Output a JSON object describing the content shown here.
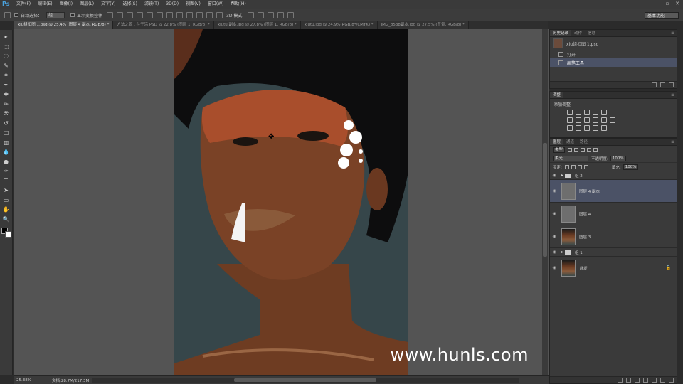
{
  "app": {
    "logo": "Ps",
    "menu": [
      "文件(F)",
      "编辑(E)",
      "图像(I)",
      "图层(L)",
      "文字(Y)",
      "选择(S)",
      "滤镜(T)",
      "3D(D)",
      "视图(V)",
      "窗口(W)",
      "帮助(H)"
    ],
    "window_controls": [
      "–",
      "▫",
      "✕"
    ]
  },
  "options_bar": {
    "auto_select_label": "自动选择：",
    "auto_select_value": "组",
    "show_transform_label": "显示变换控件",
    "mode_3d_label": "3D 模式:",
    "workspace": "基本功能"
  },
  "tabs": [
    {
      "label": "xiu组扣图 1.psd @ 25.4% (图层 4 副本, RGB/8) *",
      "active": true
    },
    {
      "label": "方法之源 , 在于活 PSD @ 22.8% (图层 1, RGB/8) *",
      "active": false
    },
    {
      "label": "xiutu 副本.jpg @ 27.8% (图层 1, RGB/8) *",
      "active": false
    },
    {
      "label": "xiutu.jpg @ 24.9%(RGB/8*/CMYK) *",
      "active": false
    },
    {
      "label": "IMG_8538副本.jpg @ 27.5% (背景, RGB/8) *",
      "active": false
    }
  ],
  "tools": [
    "move-icon",
    "marquee-icon",
    "lasso-icon",
    "quick-select-icon",
    "crop-icon",
    "eyedropper-icon",
    "healing-icon",
    "brush-icon",
    "clone-stamp-icon",
    "history-brush-icon",
    "eraser-icon",
    "gradient-icon",
    "blur-icon",
    "dodge-icon",
    "pen-icon",
    "type-icon",
    "path-select-icon",
    "shape-icon",
    "hand-icon",
    "zoom-icon"
  ],
  "tool_glyphs": [
    "▸",
    "⬚",
    "◌",
    "✎",
    "⌗",
    "✒",
    "✚",
    "✏",
    "⚒",
    "↺",
    "◫",
    "▥",
    "💧",
    "●",
    "✑",
    "T",
    "➤",
    "▭",
    "✋",
    "🔍"
  ],
  "colors": {
    "accent_selected": "#4b5266",
    "foreground": "#000000",
    "background": "#ffffff"
  },
  "status": {
    "zoom": "25.38%",
    "doc_size": "文档:28.7M/217.3M"
  },
  "watermark": "www.hunls.com",
  "history_panel": {
    "tabs": [
      "历史记录",
      "动作",
      "信息"
    ],
    "snapshot": "xiu组扣图 1.psd",
    "items": [
      {
        "label": "打开",
        "selected": false
      },
      {
        "label": "画笔工具",
        "selected": true
      }
    ]
  },
  "adjust_panel": {
    "tab": "调整",
    "title": "添加调整"
  },
  "layers_panel": {
    "tabs": [
      "图层",
      "通道",
      "路径"
    ],
    "filter_kind": "类型",
    "blend_mode": "柔光",
    "opacity_label": "不透明度:",
    "opacity_value": "100%",
    "lock_label": "锁定:",
    "fill_label": "填充:",
    "fill_value": "100%",
    "layers": [
      {
        "name": "组 2",
        "type": "group",
        "selected": false
      },
      {
        "name": "图层 4 副本",
        "type": "gray",
        "selected": true
      },
      {
        "name": "图层 4",
        "type": "gray",
        "selected": false
      },
      {
        "name": "图层 3",
        "type": "photo",
        "selected": false
      },
      {
        "name": "组 1",
        "type": "group",
        "selected": false
      },
      {
        "name": "背景",
        "type": "photo",
        "selected": false,
        "locked": true
      }
    ]
  }
}
